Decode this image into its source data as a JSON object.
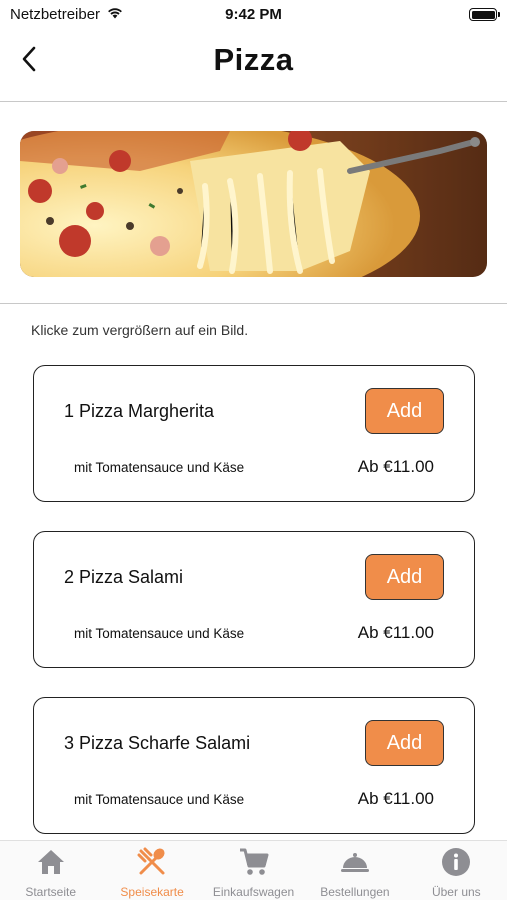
{
  "status": {
    "carrier": "Netzbetreiber",
    "time": "9:42 PM"
  },
  "header": {
    "title": "Pizza",
    "back_icon": "chevron-left-icon"
  },
  "hero": {
    "image": "pizza-cheese-pull-photo"
  },
  "hint": "Klicke zum vergrößern auf ein Bild.",
  "items": [
    {
      "name": "1 Pizza Margherita",
      "add_label": "Add",
      "description": "mit Tomatensauce und Käse",
      "price": "Ab €11.00"
    },
    {
      "name": "2 Pizza Salami",
      "add_label": "Add",
      "description": "mit Tomatensauce und Käse",
      "price": "Ab €11.00"
    },
    {
      "name": "3 Pizza Scharfe Salami",
      "add_label": "Add",
      "description": "mit Tomatensauce und Käse",
      "price": "Ab €11.00"
    }
  ],
  "tabs": [
    {
      "label": "Startseite",
      "icon": "home-icon",
      "active": false
    },
    {
      "label": "Speisekarte",
      "icon": "fork-spoon-icon",
      "active": true
    },
    {
      "label": "Einkaufswagen",
      "icon": "cart-icon",
      "active": false
    },
    {
      "label": "Bestellungen",
      "icon": "cloche-icon",
      "active": false
    },
    {
      "label": "Über uns",
      "icon": "info-icon",
      "active": false
    }
  ],
  "colors": {
    "accent": "#f08d4a",
    "inactive": "#8e8e93"
  }
}
